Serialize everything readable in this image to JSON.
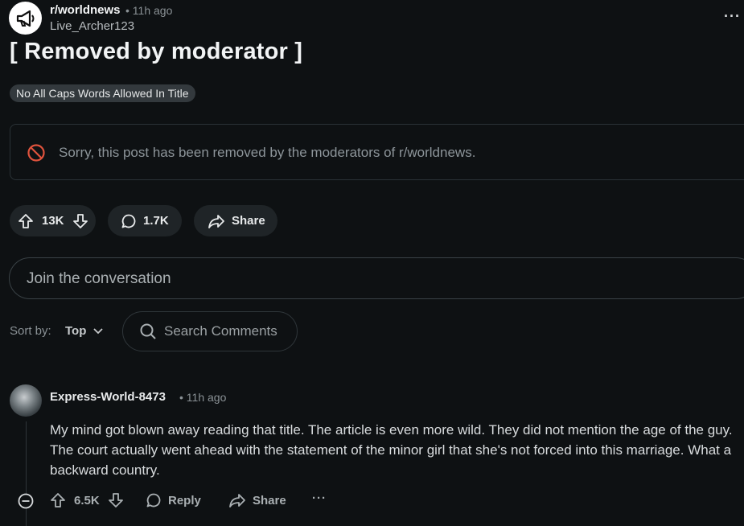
{
  "post": {
    "subreddit": "r/worldnews",
    "time": "• 11h ago",
    "author": "Live_Archer123",
    "more_label": "···",
    "title": "[ Removed by moderator ]",
    "flair": "No All Caps Words Allowed In Title",
    "removed_notice": "Sorry, this post has been removed by the moderators of r/worldnews.",
    "upvotes": "13K",
    "comments": "1.7K",
    "share_label": "Share"
  },
  "conversation": {
    "placeholder": "Join the conversation"
  },
  "sort": {
    "label": "Sort by:",
    "value": "Top",
    "search_placeholder": "Search Comments"
  },
  "comment": {
    "author": "Express-World-8473",
    "time": "• 11h ago",
    "body": "My mind got blown away reading that title. The article is even more wild. They did not mention the age of the guy. The court actually went ahead with the statement of the minor girl that she's not forced into this marriage. What a backward country.",
    "votes": "6.5K",
    "reply_label": "Reply",
    "share_label": "Share",
    "more_label": "···"
  },
  "icons": {
    "subreddit": "megaphone-icon",
    "removed": "ban-icon",
    "upvote": "arrow-up-icon",
    "downvote": "arrow-down-icon",
    "comment": "speech-bubble-icon",
    "share": "share-arrow-icon",
    "search": "search-icon",
    "sort": "chevron-down-icon",
    "collapse": "minus-circle-icon"
  },
  "colors": {
    "background": "#0e1113",
    "removed_icon": "#e0533d",
    "pill": "#1f2427"
  }
}
